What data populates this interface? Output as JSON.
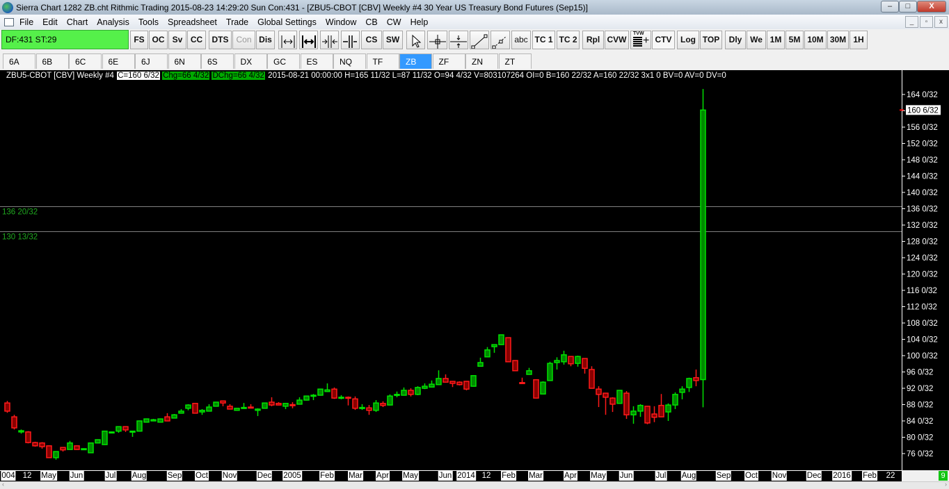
{
  "window": {
    "title": "Sierra Chart 1282 ZB.cht  Rithmic Trading 2015-08-23  14:29:20 Sun  Con:431 - [ZBU5-CBOT [CBV]  Weekly  #4  30 Year US Treasury Bond Futures (Sep15)]",
    "minimize": "–",
    "restore": "□",
    "close": "X"
  },
  "menu": [
    "File",
    "Edit",
    "Chart",
    "Analysis",
    "Tools",
    "Spreadsheet",
    "Trade",
    "Global Settings",
    "Window",
    "CB",
    "CW",
    "Help"
  ],
  "mdi": {
    "minimize": "_",
    "restore": "▫",
    "close": "x"
  },
  "toolbar": {
    "status": "DF:431  ST:29",
    "buttons": [
      "FS",
      "OC",
      "Sv",
      "CC",
      "DTS",
      "Con",
      "Dis",
      "CS",
      "SW",
      "abc",
      "TC 1",
      "TC 2",
      "Rpl",
      "CVW",
      "CTV",
      "Log",
      "TOP",
      "Dly",
      "We",
      "1M",
      "5M",
      "10M",
      "30M",
      "1H"
    ],
    "tvw_label": "TVW"
  },
  "tabs": [
    "6A",
    "6B",
    "6C",
    "6E",
    "6J",
    "6N",
    "6S",
    "DX",
    "GC",
    "ES",
    "NQ",
    "TF",
    "ZB",
    "ZF",
    "ZN",
    "ZT"
  ],
  "selected_tab": "ZB",
  "info": {
    "symbol": "ZBU5-CBOT [CBV]  Weekly  #4",
    "close": "C=160 6/32",
    "chg": "Chg=66 4/32",
    "dchg": "DChg=66 4/32",
    "rest": "2015-08-21 00:00:00 H=165 11/32 L=87 11/32 O=94 4/32 V=803107264 OI=0 B=160 22/32 A=160 22/32 3x1 0 BV=0 AV=0 DV=0"
  },
  "status_badge": "9",
  "colors": {
    "up": "#00e000",
    "up_fill": "#008a00",
    "down": "#ff1a1a",
    "down_fill": "#8a0000",
    "tab_selected": "#3399ff",
    "status_green": "#55f04a"
  },
  "chart_data": {
    "type": "candlestick",
    "title": "ZBU5-CBOT [CBV] Weekly",
    "ylim": [
      74,
      167
    ],
    "y_ticks": [
      164,
      160,
      156,
      152,
      148,
      144,
      140,
      136,
      132,
      128,
      124,
      120,
      116,
      112,
      108,
      104,
      100,
      96,
      92,
      88,
      84,
      80,
      76
    ],
    "y_tick_suffix": " 0/32",
    "current_price": 160.1875,
    "current_price_label": "160 6/32",
    "hlines": [
      {
        "value": 136.625,
        "label": "136 20/32"
      },
      {
        "value": 130.40625,
        "label": "130 13/32"
      }
    ],
    "x_labels": [
      "004",
      "12",
      "May",
      "Jun",
      "Jul",
      "Aug",
      "Sep",
      "Oct",
      "Nov",
      "Dec",
      "2005",
      "Feb",
      "Mar",
      "Apr",
      "May",
      "Jun",
      "2014",
      "12",
      "Feb",
      "Mar",
      "Apr",
      "May",
      "Jun",
      "Jul",
      "Aug",
      "Sep",
      "Oct",
      "Nov",
      "Dec",
      "2016",
      "Feb",
      "22"
    ],
    "ohlc": [
      [
        88.4,
        88.9,
        86.0,
        86.4
      ],
      [
        85.0,
        85.5,
        81.9,
        82.3
      ],
      [
        81.3,
        81.9,
        80.9,
        81.6
      ],
      [
        81.3,
        81.5,
        78.5,
        78.7
      ],
      [
        78.7,
        78.9,
        77.7,
        77.9
      ],
      [
        78.6,
        78.8,
        77.2,
        77.7
      ],
      [
        77.9,
        78.0,
        74.9,
        75.0
      ],
      [
        75.0,
        76.6,
        74.5,
        76.5
      ],
      [
        77.5,
        77.6,
        76.5,
        76.9
      ],
      [
        77.0,
        79.1,
        77.0,
        78.6
      ],
      [
        77.9,
        78.0,
        76.9,
        77.0
      ],
      [
        77.1,
        77.3,
        77.0,
        77.2
      ],
      [
        76.2,
        78.7,
        76.1,
        78.6
      ],
      [
        78.6,
        79.5,
        78.5,
        79.4
      ],
      [
        78.2,
        81.6,
        78.1,
        81.5
      ],
      [
        81.2,
        81.4,
        81.2,
        81.3
      ],
      [
        81.5,
        82.7,
        81.1,
        82.6
      ],
      [
        82.6,
        82.7,
        81.3,
        81.8
      ],
      [
        81.4,
        81.6,
        80.1,
        81.5
      ],
      [
        81.5,
        84.1,
        81.4,
        84.0
      ],
      [
        83.7,
        84.6,
        83.6,
        84.5
      ],
      [
        84.0,
        84.5,
        83.9,
        84.3
      ],
      [
        83.7,
        84.6,
        83.6,
        84.5
      ],
      [
        85.0,
        85.9,
        83.9,
        84.0
      ],
      [
        84.7,
        85.7,
        84.6,
        85.5
      ],
      [
        85.9,
        86.9,
        85.8,
        86.4
      ],
      [
        87.1,
        88.1,
        86.6,
        87.9
      ],
      [
        88.3,
        88.4,
        85.8,
        85.9
      ],
      [
        86.2,
        86.9,
        85.5,
        86.6
      ],
      [
        86.4,
        88.1,
        86.3,
        87.4
      ],
      [
        87.6,
        88.7,
        87.5,
        88.6
      ],
      [
        88.9,
        89.0,
        87.6,
        88.4
      ],
      [
        87.6,
        88.1,
        86.8,
        86.9
      ],
      [
        86.6,
        87.2,
        86.5,
        87.1
      ],
      [
        87.2,
        88.4,
        87.1,
        87.3
      ],
      [
        87.4,
        88.1,
        87.2,
        87.3
      ],
      [
        86.6,
        87.1,
        85.2,
        86.9
      ],
      [
        87.1,
        88.5,
        87.0,
        88.4
      ],
      [
        88.6,
        89.8,
        87.6,
        87.9
      ],
      [
        88.3,
        88.6,
        87.8,
        87.9
      ],
      [
        87.6,
        88.4,
        86.9,
        88.3
      ],
      [
        88.0,
        88.6,
        87.1,
        87.9
      ],
      [
        88.1,
        89.8,
        88.0,
        89.1
      ],
      [
        89.1,
        90.2,
        89.0,
        90.1
      ],
      [
        90.2,
        90.6,
        89.1,
        90.3
      ],
      [
        90.3,
        91.9,
        90.2,
        91.8
      ],
      [
        91.2,
        93.2,
        91.1,
        91.6
      ],
      [
        91.8,
        92.2,
        89.4,
        89.6
      ],
      [
        89.7,
        90.3,
        89.3,
        89.8
      ],
      [
        89.8,
        90.0,
        87.8,
        89.7
      ],
      [
        89.4,
        90.0,
        86.7,
        87.1
      ],
      [
        87.2,
        88.1,
        86.7,
        87.3
      ],
      [
        87.2,
        87.9,
        85.5,
        86.6
      ],
      [
        86.6,
        89.1,
        86.2,
        88.4
      ],
      [
        88.3,
        88.8,
        87.4,
        87.8
      ],
      [
        87.9,
        90.5,
        87.8,
        90.1
      ],
      [
        90.4,
        91.2,
        89.8,
        90.5
      ],
      [
        90.3,
        92.2,
        90.2,
        91.5
      ],
      [
        91.5,
        92.0,
        90.0,
        90.5
      ],
      [
        90.5,
        92.5,
        90.3,
        92.2
      ],
      [
        92.0,
        93.2,
        91.8,
        92.5
      ],
      [
        92.3,
        93.9,
        92.2,
        93.0
      ],
      [
        92.9,
        96.4,
        92.8,
        94.4
      ],
      [
        94.4,
        95.4,
        93.4,
        93.5
      ],
      [
        93.7,
        93.8,
        92.3,
        93.2
      ],
      [
        93.5,
        93.7,
        92.7,
        92.9
      ],
      [
        93.7,
        93.8,
        91.5,
        91.8
      ],
      [
        92.5,
        95.2,
        92.4,
        95.1
      ],
      [
        97.4,
        99.5,
        97.3,
        98.3
      ],
      [
        99.7,
        102.1,
        99.6,
        101.4
      ],
      [
        102.2,
        102.8,
        100.7,
        102.7
      ],
      [
        102.7,
        105.2,
        102.6,
        105.1
      ],
      [
        104.4,
        104.5,
        98.4,
        98.5
      ],
      [
        98.8,
        98.9,
        96.2,
        96.3
      ],
      [
        93.4,
        94.6,
        93.2,
        93.3
      ],
      [
        95.4,
        97.0,
        95.3,
        96.3
      ],
      [
        94.1,
        94.2,
        89.5,
        89.6
      ],
      [
        90.6,
        93.7,
        90.5,
        93.5
      ],
      [
        93.9,
        98.5,
        93.8,
        98.1
      ],
      [
        98.3,
        99.6,
        96.6,
        98.8
      ],
      [
        98.5,
        101.2,
        97.8,
        100.2
      ],
      [
        99.8,
        99.9,
        97.4,
        98.0
      ],
      [
        98.1,
        100.0,
        97.3,
        99.8
      ],
      [
        99.3,
        99.4,
        95.6,
        96.9
      ],
      [
        96.6,
        97.4,
        91.9,
        92.0
      ],
      [
        91.8,
        92.5,
        87.4,
        90.5
      ],
      [
        90.8,
        90.9,
        85.5,
        89.8
      ],
      [
        89.6,
        89.8,
        86.2,
        88.1
      ],
      [
        88.3,
        91.6,
        88.2,
        91.5
      ],
      [
        90.8,
        91.3,
        84.5,
        85.5
      ],
      [
        85.5,
        87.6,
        83.3,
        86.4
      ],
      [
        86.4,
        88.1,
        85.0,
        87.8
      ],
      [
        87.6,
        87.7,
        83.2,
        83.5
      ],
      [
        85.7,
        87.6,
        83.7,
        84.9
      ],
      [
        87.8,
        90.6,
        84.9,
        85.0
      ],
      [
        86.2,
        88.3,
        84.0,
        87.9
      ],
      [
        87.9,
        91.0,
        86.9,
        90.5
      ],
      [
        91.0,
        92.5,
        89.3,
        91.8
      ],
      [
        92.2,
        94.6,
        91.1,
        94.4
      ],
      [
        94.6,
        96.6,
        92.5,
        93.9
      ],
      [
        94.125,
        165.34,
        87.34,
        160.19
      ]
    ]
  }
}
